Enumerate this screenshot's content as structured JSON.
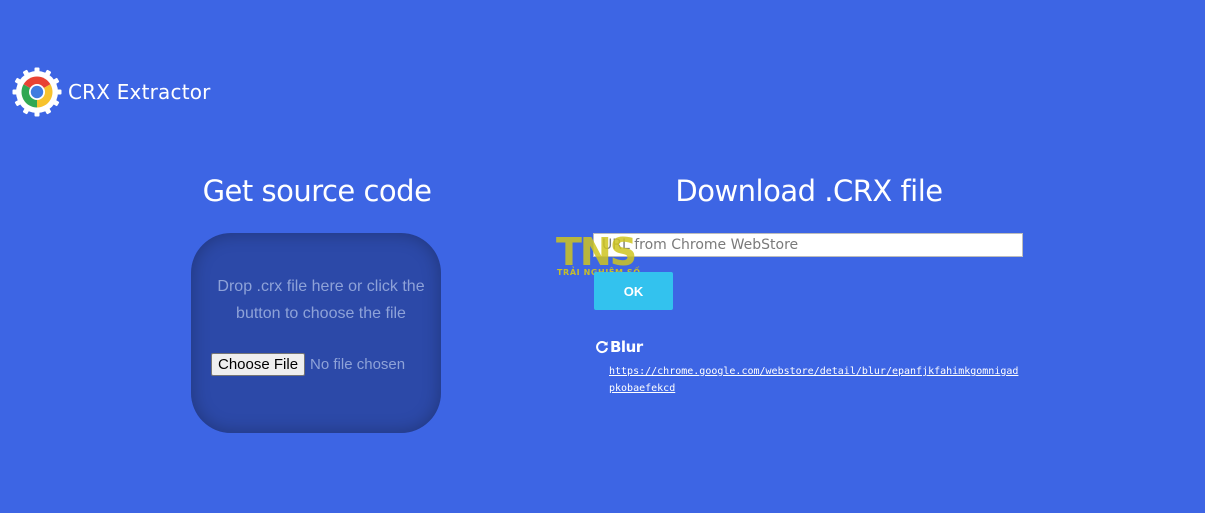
{
  "brand": {
    "name": "CRX Extractor",
    "logo_icon": "chrome-gear-logo-icon"
  },
  "left": {
    "title": "Get source code",
    "drop_text": "Drop .crx file here or click the button to choose the file",
    "choose_button": "Choose File",
    "file_status": "No file chosen"
  },
  "right": {
    "title": "Download .CRX file",
    "url_placeholder": "URL from Chrome WebStore",
    "ok_button": "OK"
  },
  "recent": {
    "icon": "refresh-icon",
    "name": "Blur",
    "url": "https://chrome.google.com/webstore/detail/blur/epanfjkfahimkgomnigadpkobaefekcd"
  },
  "watermark": {
    "big": "TNS",
    "small": "TRẢI NGHIỆM SỐ"
  },
  "colors": {
    "background": "#3d65e4",
    "dropzone": "#2c49a8",
    "ok_button": "#33c2ee",
    "watermark": "#cec420"
  }
}
